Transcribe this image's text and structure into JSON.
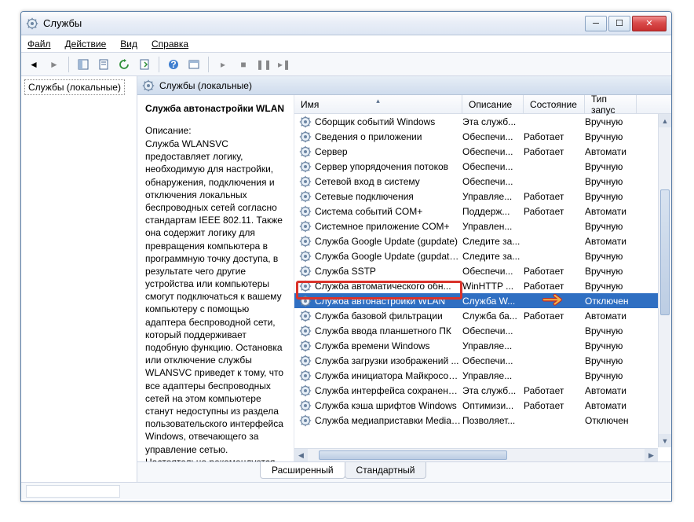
{
  "window": {
    "title": "Службы"
  },
  "menu": {
    "file": "Файл",
    "action": "Действие",
    "view": "Вид",
    "help": "Справка"
  },
  "tree": {
    "root": "Службы (локальные)"
  },
  "header": {
    "title": "Службы (локальные)"
  },
  "desc": {
    "name": "Служба автонастройки WLAN",
    "label": "Описание:",
    "text": "Служба WLANSVC предоставляет логику, необходимую для настройки, обнаружения, подключения и отключения локальных беспроводных сетей согласно стандартам IEEE 802.11. Также она содержит логику для превращения компьютера в программную точку доступа, в результате чего другие устройства или компьютеры смогут подключаться к вашему компьютеру с помощью адаптера беспроводной сети, который поддерживает подобную функцию. Остановка или отключение службы WLANSVC приведет к тому, что все адаптеры беспроводных сетей на этом компьютере станут недоступны из раздела пользовательского интерфейса Windows, отвечающего за управление сетью. Настоятельно рекомендуется"
  },
  "cols": {
    "name": "Имя",
    "desc": "Описание",
    "state": "Состояние",
    "start": "Тип запус"
  },
  "rows": [
    {
      "n": "Сборщик событий Windows",
      "d": "Эта служб...",
      "s": "",
      "t": "Вручную"
    },
    {
      "n": "Сведения о приложении",
      "d": "Обеспечи...",
      "s": "Работает",
      "t": "Вручную"
    },
    {
      "n": "Сервер",
      "d": "Обеспечи...",
      "s": "Работает",
      "t": "Автомати"
    },
    {
      "n": "Сервер упорядочения потоков",
      "d": "Обеспечи...",
      "s": "",
      "t": "Вручную"
    },
    {
      "n": "Сетевой вход в систему",
      "d": "Обеспечи...",
      "s": "",
      "t": "Вручную"
    },
    {
      "n": "Сетевые подключения",
      "d": "Управляе...",
      "s": "Работает",
      "t": "Вручную"
    },
    {
      "n": "Система событий COM+",
      "d": "Поддерж...",
      "s": "Работает",
      "t": "Автомати"
    },
    {
      "n": "Системное приложение COM+",
      "d": "Управлен...",
      "s": "",
      "t": "Вручную"
    },
    {
      "n": "Служба Google Update (gupdate)",
      "d": "Следите за...",
      "s": "",
      "t": "Автомати"
    },
    {
      "n": "Служба Google Update (gupdatem)",
      "d": "Следите за...",
      "s": "",
      "t": "Вручную"
    },
    {
      "n": "Служба SSTP",
      "d": "Обеспечи...",
      "s": "Работает",
      "t": "Вручную"
    },
    {
      "n": "Служба автоматического обн...",
      "d": "WinHTTP ...",
      "s": "Работает",
      "t": "Вручную"
    },
    {
      "n": "Служба автонастройки WLAN",
      "d": "Служба W...",
      "s": "",
      "t": "Отключен",
      "sel": true
    },
    {
      "n": "Служба базовой фильтрации",
      "d": "Служба ба...",
      "s": "Работает",
      "t": "Автомати"
    },
    {
      "n": "Служба ввода планшетного ПК",
      "d": "Обеспечи...",
      "s": "",
      "t": "Вручную"
    },
    {
      "n": "Служба времени Windows",
      "d": "Управляе...",
      "s": "",
      "t": "Вручную"
    },
    {
      "n": "Служба загрузки изображений ...",
      "d": "Обеспечи...",
      "s": "",
      "t": "Вручную"
    },
    {
      "n": "Служба инициатора Майкрософ...",
      "d": "Управляе...",
      "s": "",
      "t": "Вручную"
    },
    {
      "n": "Служба интерфейса сохранения ...",
      "d": "Эта служб...",
      "s": "Работает",
      "t": "Автомати"
    },
    {
      "n": "Служба кэша шрифтов Windows",
      "d": "Оптимизи...",
      "s": "Работает",
      "t": "Автомати"
    },
    {
      "n": "Служба медиаприставки Media C...",
      "d": "Позволяет...",
      "s": "",
      "t": "Отключен"
    }
  ],
  "tabs": {
    "ext": "Расширенный",
    "std": "Стандартный"
  }
}
